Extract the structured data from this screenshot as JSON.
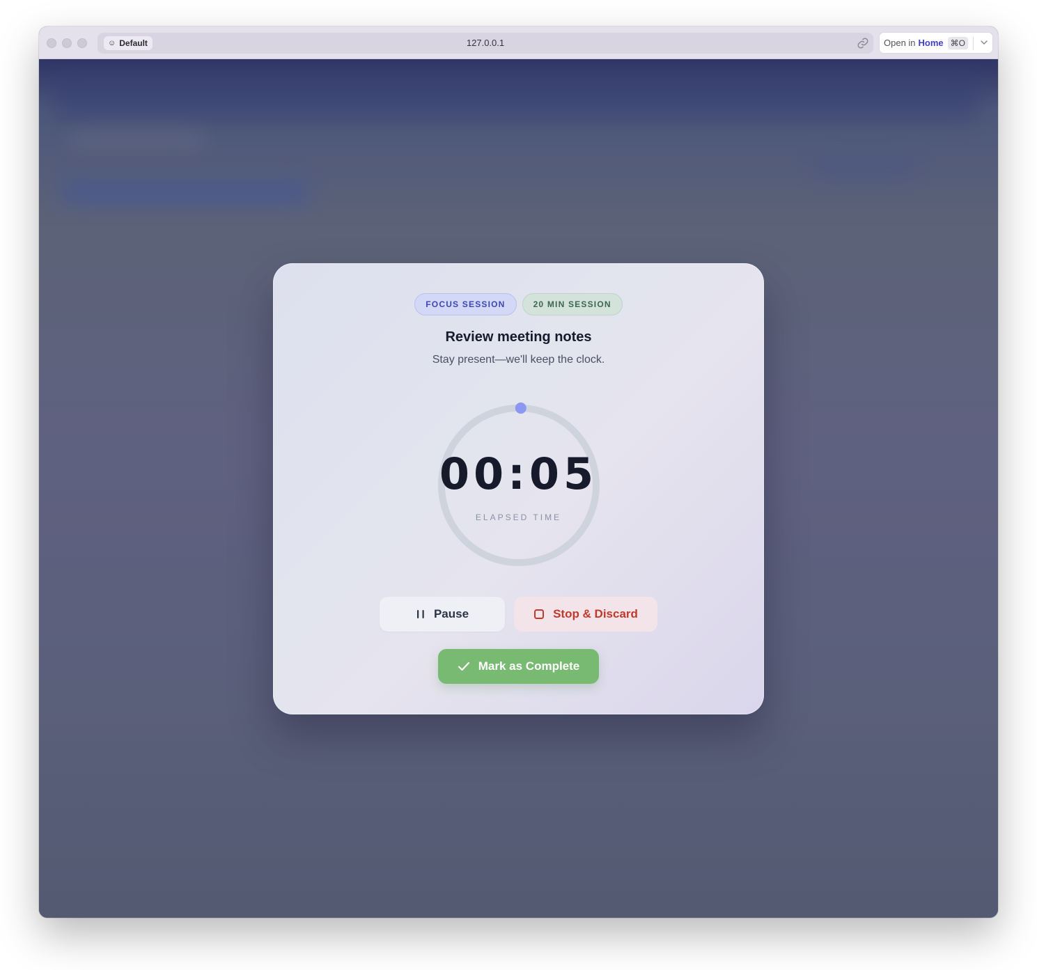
{
  "browser": {
    "profile_label": "Default",
    "url": "127.0.0.1",
    "open_in_prefix": "Open in",
    "open_in_target": "Home",
    "open_in_shortcut": "⌘O"
  },
  "session": {
    "badge_mode": "FOCUS SESSION",
    "badge_duration": "20 MIN SESSION",
    "task_title": "Review meeting notes",
    "subtitle": "Stay present—we'll keep the clock.",
    "elapsed_time": "00:05",
    "elapsed_label": "ELAPSED TIME",
    "progress_fraction": 0.004
  },
  "actions": {
    "pause_label": "Pause",
    "stop_label": "Stop & Discard",
    "complete_label": "Mark as Complete"
  },
  "colors": {
    "accent": "#7d8ef0",
    "stop": "#c0392b",
    "complete": "#78ba72"
  }
}
